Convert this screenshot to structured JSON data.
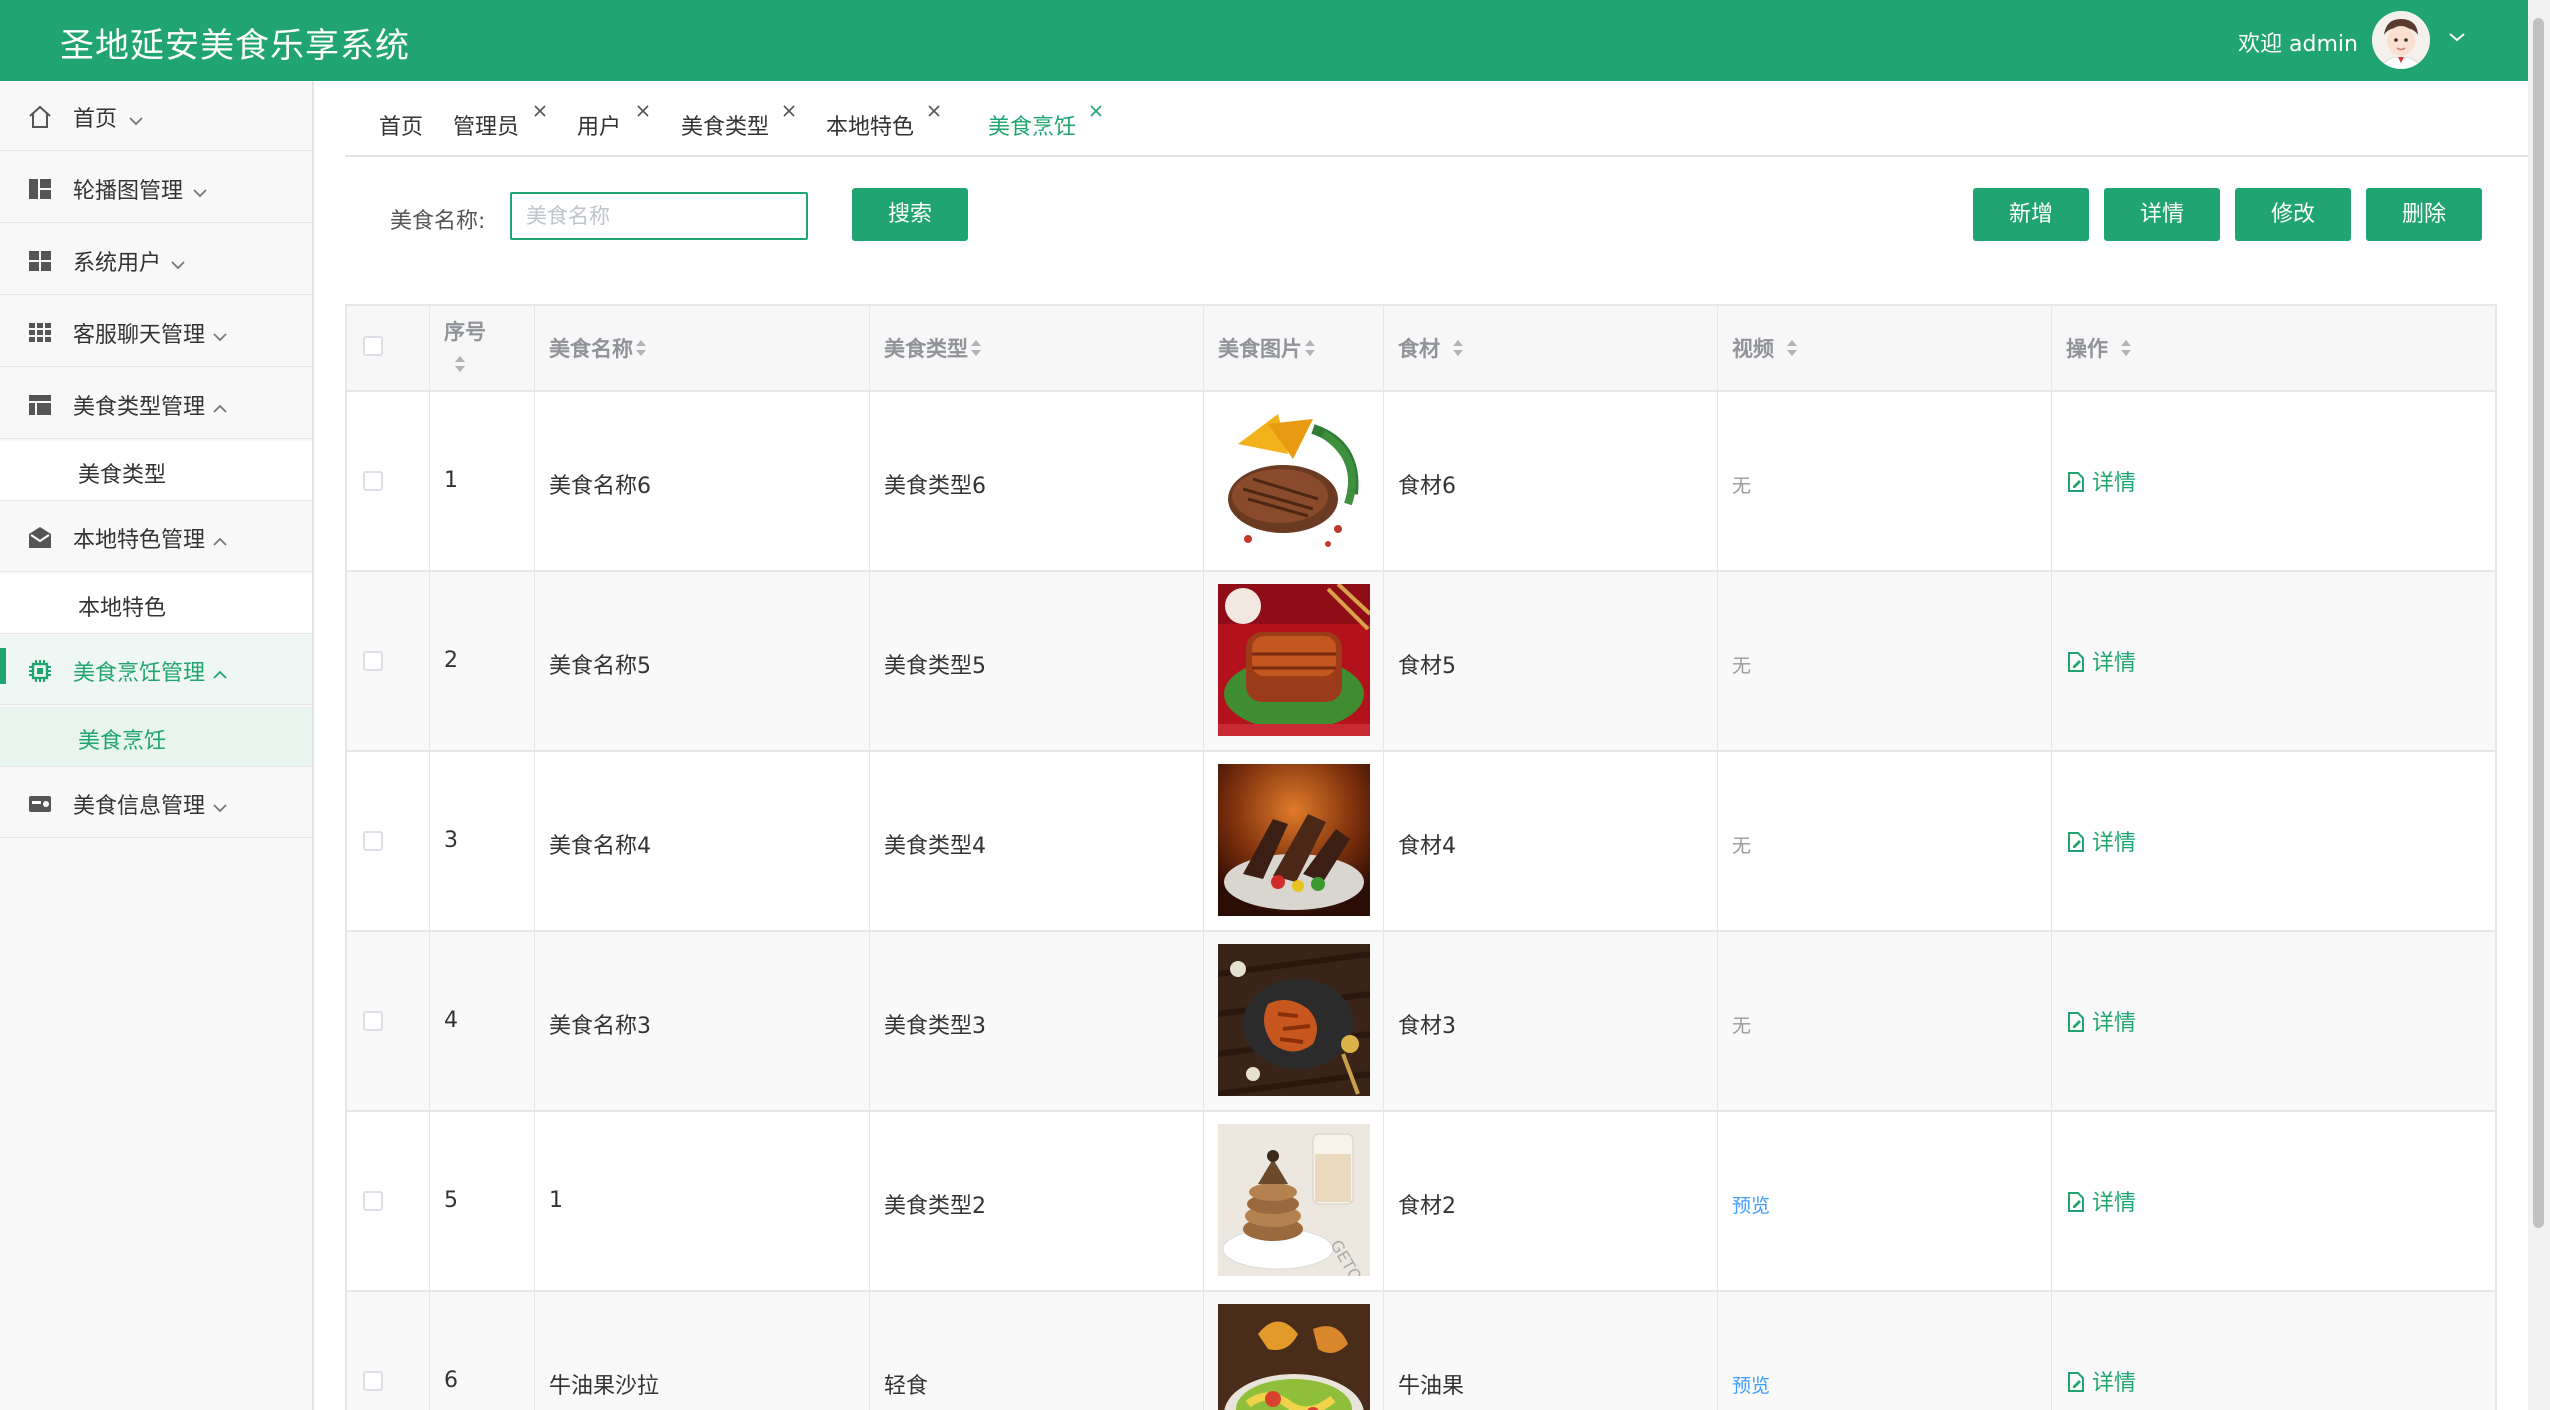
{
  "header": {
    "title": "圣地延安美食乐享系统",
    "welcome": "欢迎 admin",
    "brand_color": "#20a572"
  },
  "sidebar": {
    "items": [
      {
        "label": "首页",
        "icon": "home-icon"
      },
      {
        "label": "轮播图管理",
        "icon": "carousel-icon"
      },
      {
        "label": "系统用户",
        "icon": "grid-icon"
      },
      {
        "label": "客服聊天管理",
        "icon": "apps-icon"
      },
      {
        "label": "美食类型管理",
        "icon": "table-icon",
        "sub": "美食类型"
      },
      {
        "label": "本地特色管理",
        "icon": "mail-icon",
        "sub": "本地特色"
      },
      {
        "label": "美食烹饪管理",
        "icon": "chip-icon",
        "sub": "美食烹饪",
        "active": true
      },
      {
        "label": "美食信息管理",
        "icon": "card-icon"
      }
    ]
  },
  "tabs": [
    {
      "label": "首页"
    },
    {
      "label": "管理员"
    },
    {
      "label": "用户"
    },
    {
      "label": "美食类型"
    },
    {
      "label": "本地特色"
    },
    {
      "label": "美食烹饪",
      "active": true
    }
  ],
  "search": {
    "label": "美食名称:",
    "placeholder": "美食名称",
    "button": "搜索"
  },
  "actions": {
    "add": "新增",
    "detail": "详情",
    "edit": "修改",
    "delete": "删除"
  },
  "table": {
    "columns": [
      "序号",
      "美食名称",
      "美食类型",
      "美食图片",
      "食材",
      "视频",
      "操作"
    ],
    "rows": [
      {
        "index": "1",
        "name": "美食名称6",
        "type": "美食类型6",
        "ingredients": "食材6",
        "video": "无",
        "action": "详情"
      },
      {
        "index": "2",
        "name": "美食名称5",
        "type": "美食类型5",
        "ingredients": "食材5",
        "video": "无",
        "action": "详情"
      },
      {
        "index": "3",
        "name": "美食名称4",
        "type": "美食类型4",
        "ingredients": "食材4",
        "video": "无",
        "action": "详情"
      },
      {
        "index": "4",
        "name": "美食名称3",
        "type": "美食类型3",
        "ingredients": "食材3",
        "video": "无",
        "action": "详情"
      },
      {
        "index": "5",
        "name": "1",
        "type": "美食类型2",
        "ingredients": "食材2",
        "video": "预览",
        "action": "详情"
      },
      {
        "index": "6",
        "name": "牛油果沙拉",
        "type": "轻食",
        "ingredients": "牛油果",
        "video": "预览",
        "action": "详情"
      }
    ]
  }
}
